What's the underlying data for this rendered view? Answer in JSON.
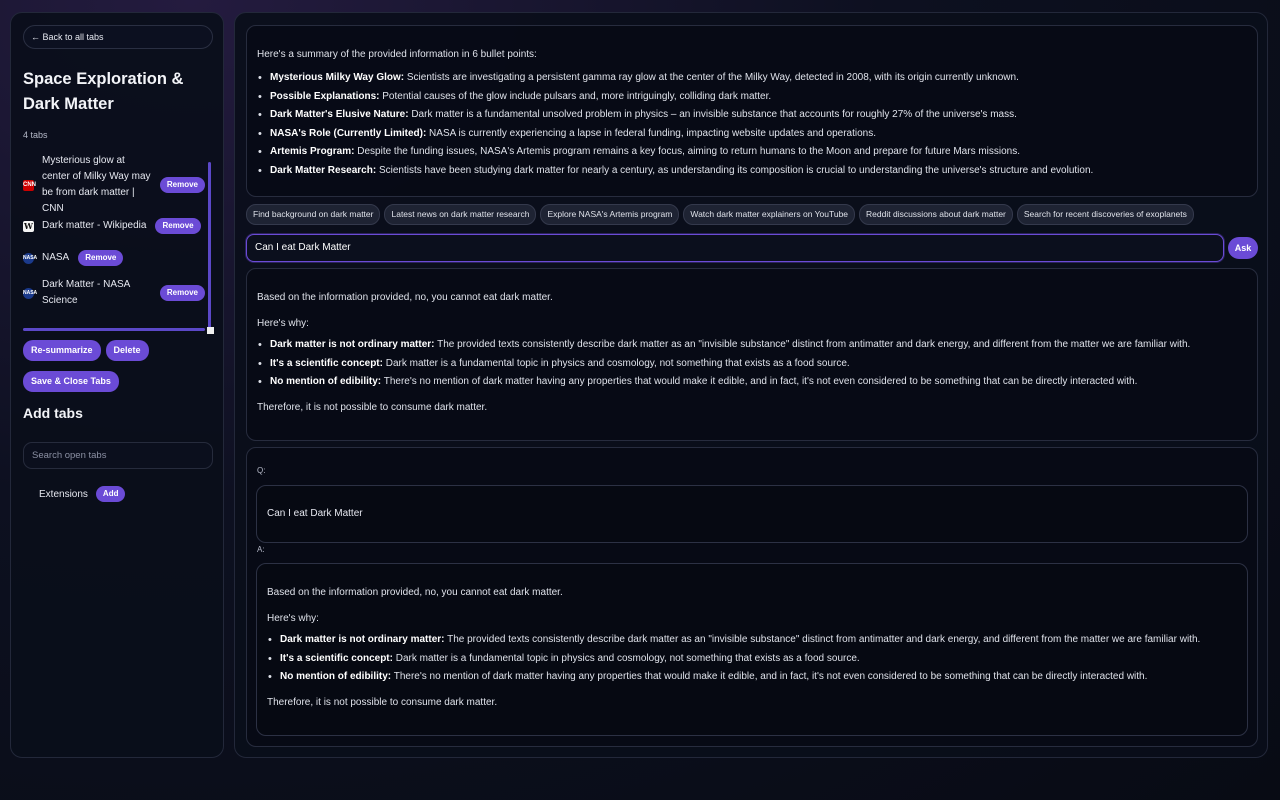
{
  "sidebar": {
    "back_label": "← Back to all tabs",
    "group_title": "Space Exploration & Dark Matter",
    "tab_count": "4 tabs",
    "tabs": [
      {
        "favicon": "cnn-icon",
        "favicon_text": "CNN",
        "title": "Mysterious glow at center of Milky Way may be from dark matter | CNN",
        "remove": "Remove"
      },
      {
        "favicon": "wikipedia-icon",
        "favicon_text": "W",
        "title": "Dark matter - Wikipedia",
        "remove": "Remove"
      },
      {
        "favicon": "nasa-icon",
        "favicon_text": "NASA",
        "title": "NASA",
        "remove": "Remove"
      },
      {
        "favicon": "nasa-icon",
        "favicon_text": "NASA",
        "title": "Dark Matter - NASA Science",
        "remove": "Remove"
      }
    ],
    "resummarize_label": "Re-summarize",
    "delete_label": "Delete",
    "save_close_label": "Save & Close Tabs",
    "add_tabs_title": "Add tabs",
    "search_placeholder": "Search open tabs",
    "extensions_label": "Extensions",
    "add_label": "Add"
  },
  "summary": {
    "intro": "Here's a summary of the provided information in 6 bullet points:",
    "bullets": [
      {
        "bold": "Mysterious Milky Way Glow:",
        "text": " Scientists are investigating a persistent gamma ray glow at the center of the Milky Way, detected in 2008, with its origin currently unknown."
      },
      {
        "bold": "Possible Explanations:",
        "text": " Potential causes of the glow include pulsars and, more intriguingly, colliding dark matter."
      },
      {
        "bold": "Dark Matter's Elusive Nature:",
        "text": " Dark matter is a fundamental unsolved problem in physics – an invisible substance that accounts for roughly 27% of the universe's mass."
      },
      {
        "bold": "NASA's Role (Currently Limited):",
        "text": " NASA is currently experiencing a lapse in federal funding, impacting website updates and operations."
      },
      {
        "bold": "Artemis Program:",
        "text": " Despite the funding issues, NASA's Artemis program remains a key focus, aiming to return humans to the Moon and prepare for future Mars missions."
      },
      {
        "bold": "Dark Matter Research:",
        "text": " Scientists have been studying dark matter for nearly a century, as understanding its composition is crucial to understanding the universe's structure and evolution."
      }
    ]
  },
  "suggestions": [
    "Find background on dark matter",
    "Latest news on dark matter research",
    "Explore NASA's Artemis program",
    "Watch dark matter explainers on YouTube",
    "Reddit discussions about dark matter",
    "Search for recent discoveries of exoplanets"
  ],
  "ask": {
    "input_value": "Can I eat Dark Matter",
    "button_label": "Ask"
  },
  "answer": {
    "intro": "Based on the information provided, no, you cannot eat dark matter.",
    "why": "Here's why:",
    "bullets": [
      {
        "bold": "Dark matter is not ordinary matter:",
        "text": " The provided texts consistently describe dark matter as an \"invisible substance\" distinct from antimatter and dark energy, and different from the matter we are familiar with."
      },
      {
        "bold": "It's a scientific concept:",
        "text": " Dark matter is a fundamental topic in physics and cosmology, not something that exists as a food source."
      },
      {
        "bold": "No mention of edibility:",
        "text": " There's no mention of dark matter having any properties that would make it edible, and in fact, it's not even considered to be something that can be directly interacted with."
      }
    ],
    "conclusion": "Therefore, it is not possible to consume dark matter."
  },
  "qa": {
    "q_label": "Q:",
    "question": "Can I eat Dark Matter",
    "a_label": "A:"
  },
  "colors": {
    "accent": "#6b4bd6",
    "background": "#0d1020",
    "panel": "#0a0e1a"
  }
}
